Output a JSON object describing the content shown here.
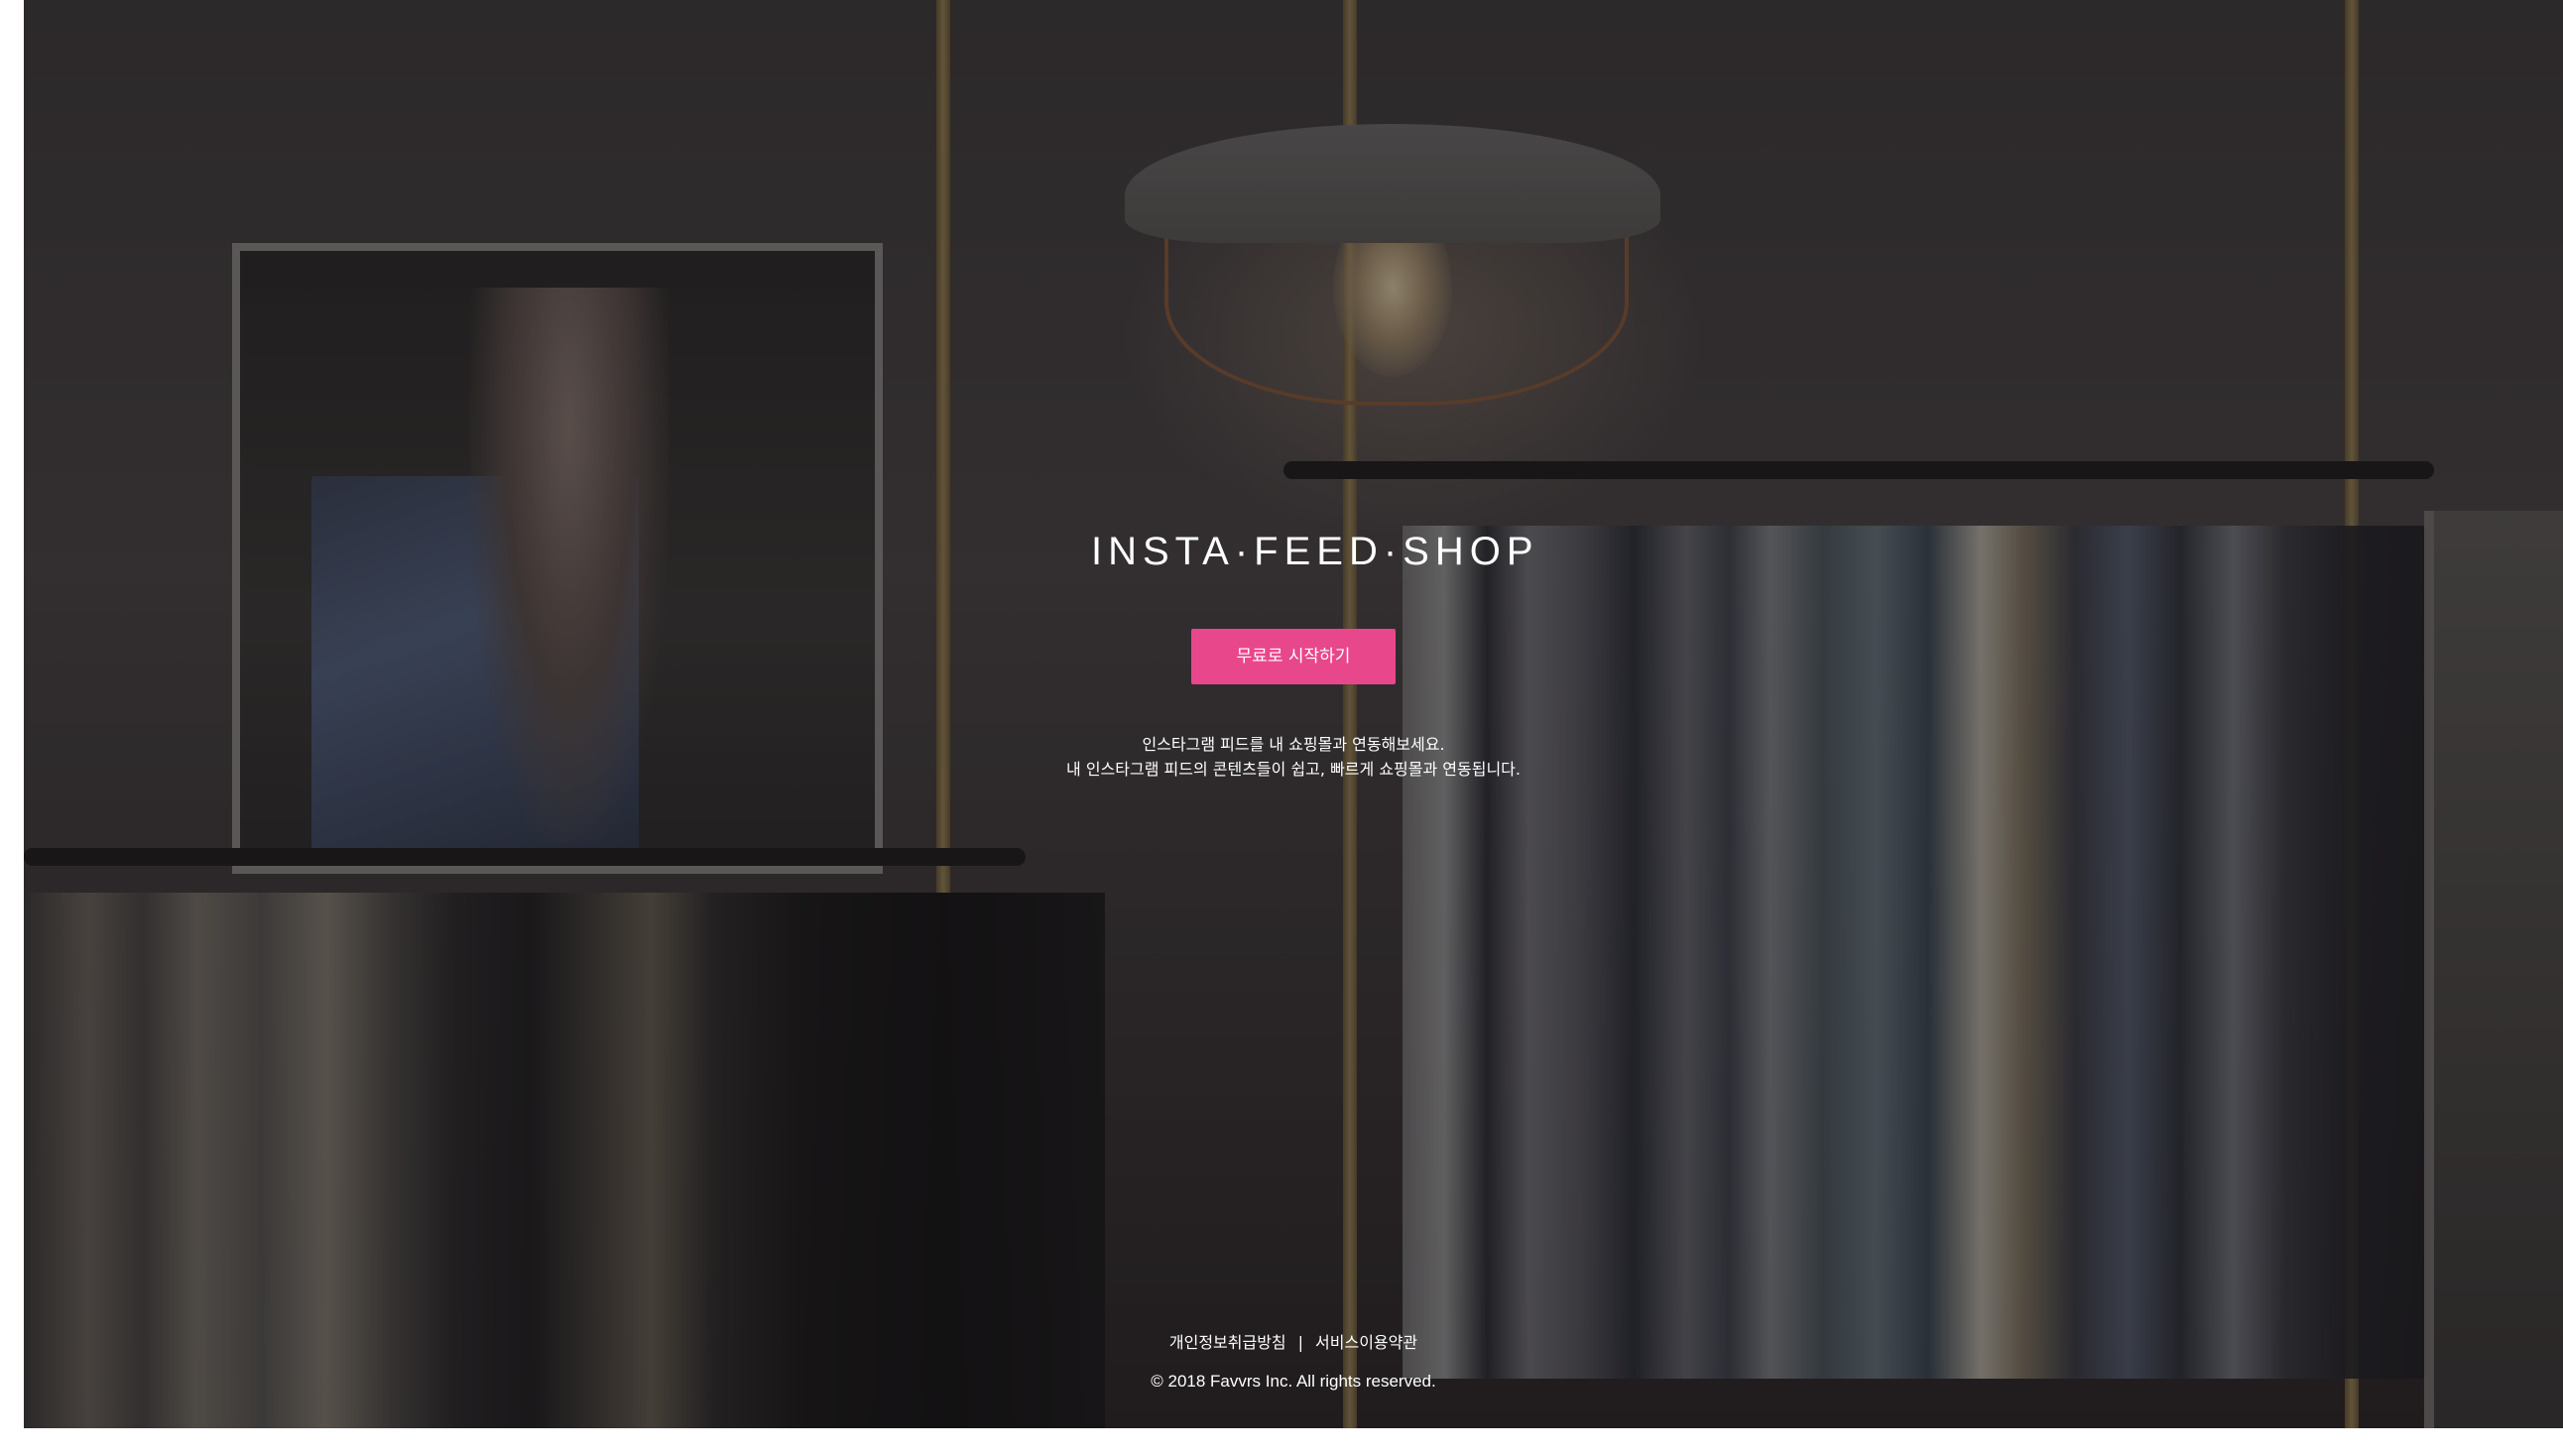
{
  "brand": {
    "logo_text": "INSTA·FEED·SHOP"
  },
  "hero": {
    "cta_label": "무료로 시작하기",
    "description_line1": "인스타그램 피드를 내 쇼핑몰과 연동해보세요.",
    "description_line2": "내 인스타그램 피드의 콘텐츠들이 쉽고, 빠르게 쇼핑몰과 연동됩니다."
  },
  "footer": {
    "privacy_label": "개인정보취급방침",
    "separator": "|",
    "terms_label": "서비스이용약관",
    "copyright": "© 2018 Favvrs Inc. All rights reserved."
  },
  "colors": {
    "accent": "#e8478b",
    "text": "#ffffff"
  }
}
